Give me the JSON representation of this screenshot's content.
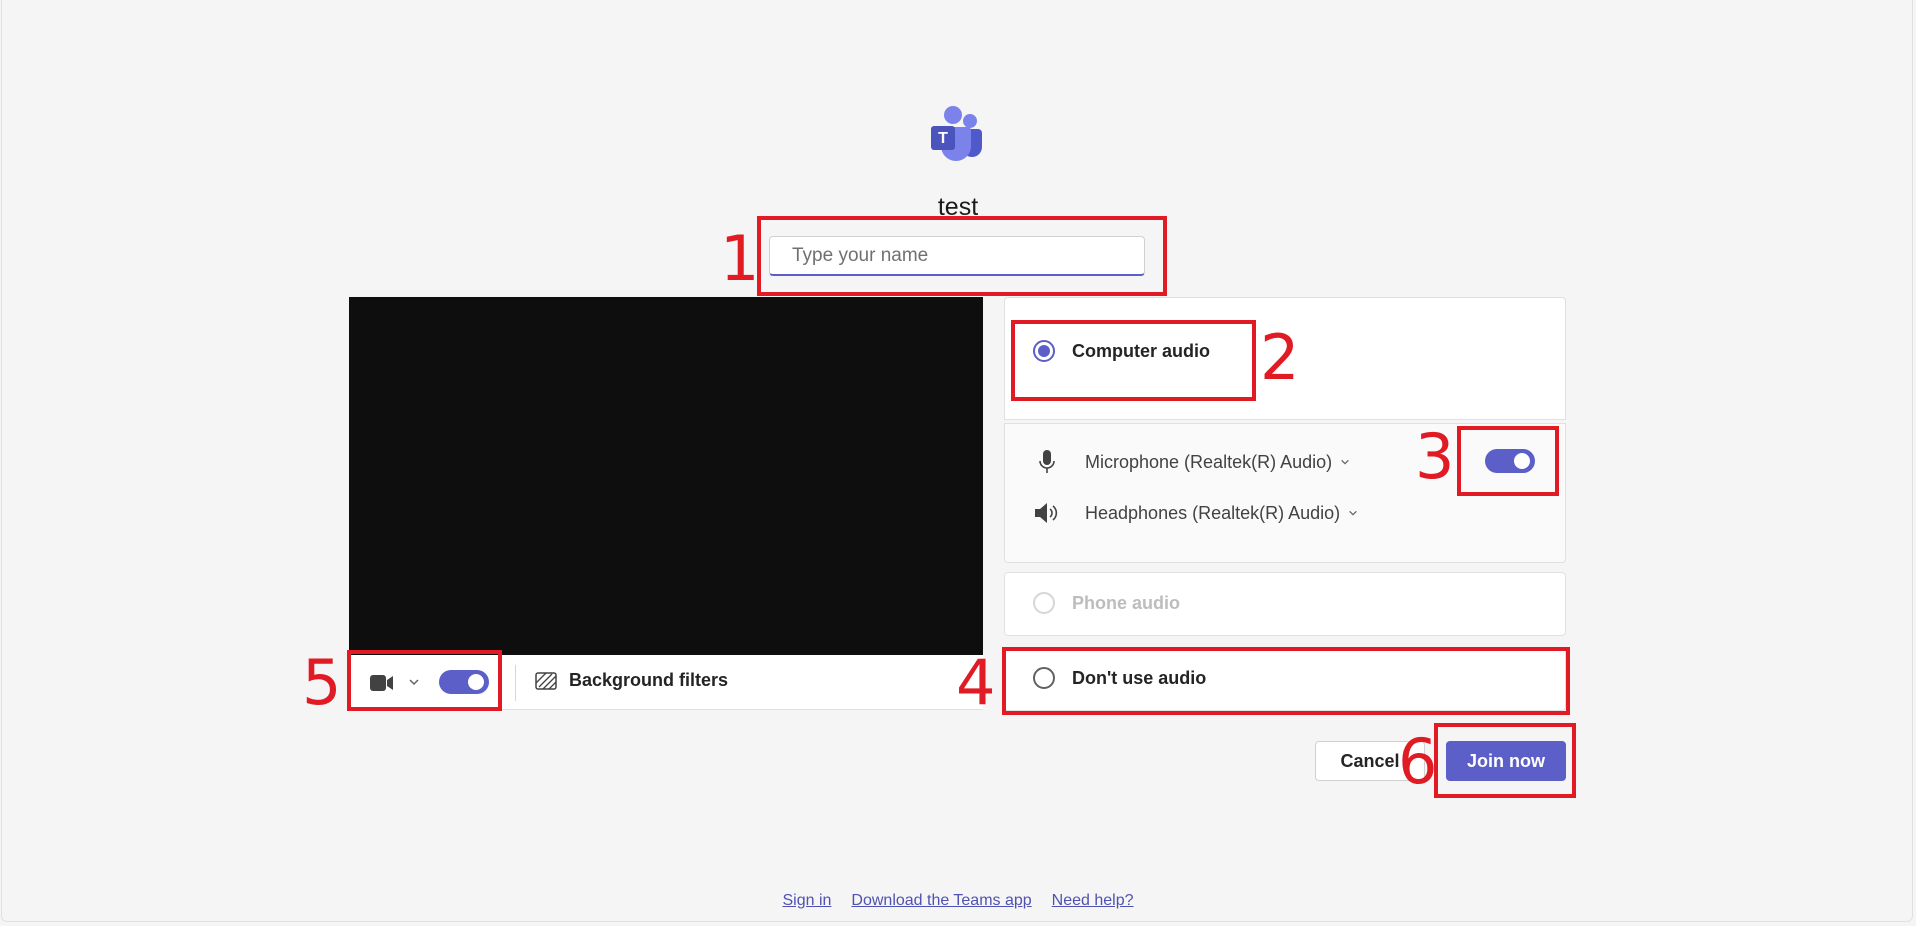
{
  "app": {
    "meeting_title": "test"
  },
  "name_field": {
    "placeholder": "Type your name",
    "value": ""
  },
  "video": {
    "background_filters_label": "Background filters"
  },
  "audio": {
    "computer_audio_label": "Computer audio",
    "microphone_label": "Microphone (Realtek(R) Audio)",
    "speaker_label": "Headphones (Realtek(R) Audio)",
    "phone_audio_label": "Phone audio",
    "no_audio_label": "Don't use audio",
    "selected": "computer_audio"
  },
  "actions": {
    "cancel_label": "Cancel",
    "join_label": "Join now"
  },
  "footer": {
    "sign_in": "Sign in",
    "download": "Download the Teams app",
    "help": "Need help?"
  },
  "annotations": [
    "1",
    "2",
    "3",
    "4",
    "5",
    "6"
  ],
  "colors": {
    "accent": "#5b5fc7",
    "annotation": "#e01b24",
    "video_bg": "#0f0e0e"
  }
}
